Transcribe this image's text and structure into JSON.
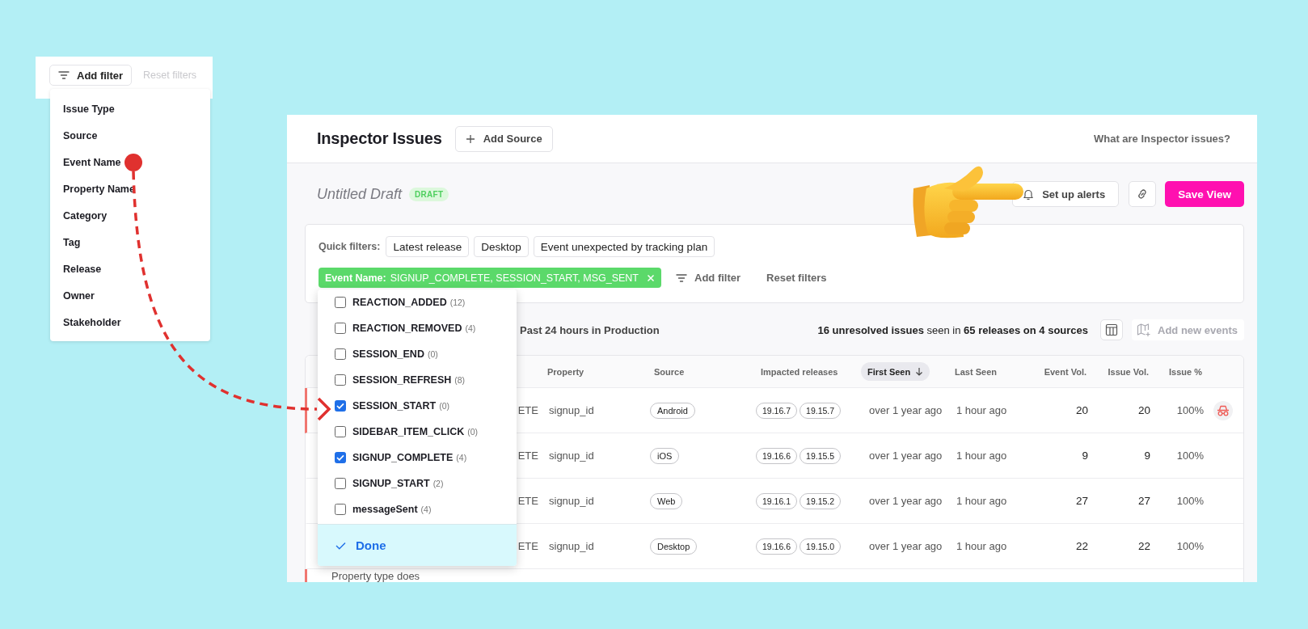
{
  "filter_menu": {
    "add_filter": "Add filter",
    "reset_filters": "Reset filters",
    "reset_disabled": true,
    "items": [
      "Issue Type",
      "Source",
      "Event Name",
      "Property Name",
      "Category",
      "Tag",
      "Release",
      "Owner",
      "Stakeholder"
    ]
  },
  "header": {
    "title": "Inspector Issues",
    "add_source": "Add Source",
    "help_link": "What are Inspector issues?"
  },
  "view": {
    "title": "Untitled Draft",
    "badge": "DRAFT",
    "alerts_button": "Set up alerts",
    "save_button": "Save View"
  },
  "filters": {
    "label": "Quick filters:",
    "quick": [
      "Latest release",
      "Desktop",
      "Event unexpected by tracking plan"
    ],
    "active": {
      "name": "Event Name:",
      "values": "SIGNUP_COMPLETE, SESSION_START, MSG_SENT"
    },
    "add_filter": "Add filter",
    "reset": "Reset filters"
  },
  "toolbar": {
    "range": "Past 24 hours in Production",
    "summary": "**16 unresolved issues** seen in **65 releases on 4 sources**",
    "add_events": {
      "label": "Add new events",
      "disabled": true
    }
  },
  "table": {
    "columns": [
      {
        "label": "Property",
        "sorted": false
      },
      {
        "label": "Source",
        "sorted": false
      },
      {
        "label": "Impacted releases",
        "sorted": false
      },
      {
        "label": "First Seen",
        "sorted": true
      },
      {
        "label": "Last Seen",
        "sorted": false
      },
      {
        "label": "Event Vol.",
        "sorted": false
      },
      {
        "label": "Issue Vol.",
        "sorted": false
      },
      {
        "label": "Issue %",
        "sorted": false
      }
    ],
    "rows": [
      {
        "kind": "issue",
        "flagged": true,
        "hovered": true,
        "event": "ETE",
        "property": "signup_id",
        "source": "Android",
        "releases": [
          "19.16.7",
          "19.15.7"
        ],
        "first_seen": "over 1 year ago",
        "last_seen": "1 hour ago",
        "event_vol": "20",
        "issue_vol": "20",
        "issue_pct": "100%"
      },
      {
        "kind": "issue",
        "flagged": false,
        "hovered": false,
        "event": "ETE",
        "property": "signup_id",
        "source": "iOS",
        "releases": [
          "19.16.6",
          "19.15.5"
        ],
        "first_seen": "over 1 year ago",
        "last_seen": "1 hour ago",
        "event_vol": "9",
        "issue_vol": "9",
        "issue_pct": "100%"
      },
      {
        "kind": "issue",
        "flagged": false,
        "hovered": false,
        "event": "ETE",
        "property": "signup_id",
        "source": "Web",
        "releases": [
          "19.16.1",
          "19.15.2"
        ],
        "first_seen": "over 1 year ago",
        "last_seen": "1 hour ago",
        "event_vol": "27",
        "issue_vol": "27",
        "issue_pct": "100%"
      },
      {
        "kind": "issue",
        "flagged": false,
        "hovered": false,
        "event": "ETE",
        "property": "signup_id",
        "source": "Desktop",
        "releases": [
          "19.16.6",
          "19.15.0"
        ],
        "first_seen": "over 1 year ago",
        "last_seen": "1 hour ago",
        "event_vol": "22",
        "issue_vol": "22",
        "issue_pct": "100%"
      },
      {
        "kind": "note",
        "flagged": true,
        "text": "Property type does"
      }
    ]
  },
  "dropdown": {
    "options": [
      {
        "label": "REACTION_ADDED",
        "count": "(12)",
        "checked": false
      },
      {
        "label": "REACTION_REMOVED",
        "count": "(4)",
        "checked": false
      },
      {
        "label": "SESSION_END",
        "count": "(0)",
        "checked": false
      },
      {
        "label": "SESSION_REFRESH",
        "count": "(8)",
        "checked": false
      },
      {
        "label": "SESSION_START",
        "count": "(0)",
        "checked": true
      },
      {
        "label": "SIDEBAR_ITEM_CLICK",
        "count": "(0)",
        "checked": false
      },
      {
        "label": "SIGNUP_COMPLETE",
        "count": "(4)",
        "checked": true
      },
      {
        "label": "SIGNUP_START",
        "count": "(2)",
        "checked": false
      },
      {
        "label": "messageSent",
        "count": "(4)",
        "checked": false
      }
    ],
    "done": "Done"
  }
}
